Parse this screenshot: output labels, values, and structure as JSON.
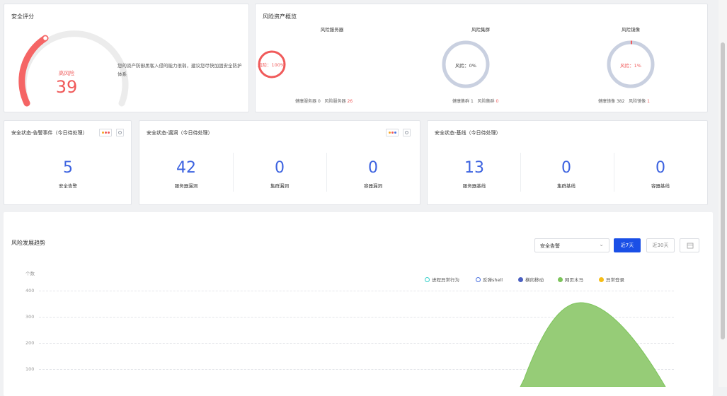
{
  "score_card": {
    "title": "安全评分",
    "level": "高风险",
    "score": "39",
    "description": "您的资产防御黑客入侵的能力很弱，建议您尽快加固安全防护体系",
    "colors": {
      "gauge": "#f56565",
      "track": "#ececec"
    }
  },
  "risk_overview": {
    "title": "风险资产概览",
    "items": [
      {
        "name": "风险服务器",
        "ring_text": "风险：100%",
        "ratio": 1.0,
        "color": "#f05a5a",
        "stat1_label": "健康服务器",
        "stat1_value": "0",
        "stat2_label": "风险服务器",
        "stat2_value": "26"
      },
      {
        "name": "风险集群",
        "ring_text": "风险：0%",
        "ratio": 0.0,
        "color": "#c9d0e0",
        "stat1_label": "健康集群",
        "stat1_value": "1",
        "stat2_label": "风险集群",
        "stat2_value": "0"
      },
      {
        "name": "风险镜像",
        "ring_text": "风险：1%",
        "ratio": 0.01,
        "color": "#f05a5a",
        "stat1_label": "健康镜像",
        "stat1_value": "382",
        "stat2_label": "风险镜像",
        "stat2_value": "1"
      }
    ]
  },
  "status_alarm": {
    "title": "安全状态-告警事件（今日待处理）",
    "items": [
      {
        "value": "5",
        "label": "安全告警"
      }
    ]
  },
  "status_vuln": {
    "title": "安全状态-漏洞（今日待处理）",
    "items": [
      {
        "value": "42",
        "label": "服务器漏洞"
      },
      {
        "value": "0",
        "label": "集群漏洞"
      },
      {
        "value": "0",
        "label": "容器漏洞"
      }
    ]
  },
  "status_baseline": {
    "title": "安全状态-基线（今日待处理）",
    "items": [
      {
        "value": "13",
        "label": "服务器基线"
      },
      {
        "value": "0",
        "label": "集群基线"
      },
      {
        "value": "0",
        "label": "容器基线"
      }
    ]
  },
  "trend": {
    "title": "风险发展趋势",
    "select_value": "安全告警",
    "btn_7": "近7天",
    "btn_30": "近30天",
    "ylabel": "个数",
    "legend": [
      {
        "name": "进程异常行为",
        "color": "#36cfc9",
        "hollow": true
      },
      {
        "name": "反弹shell",
        "color": "#4b72e0",
        "hollow": true
      },
      {
        "name": "横向移动",
        "color": "#4a5fc1",
        "hollow": false
      },
      {
        "name": "网页木马",
        "color": "#7cc45a",
        "hollow": false
      },
      {
        "name": "异常登录",
        "color": "#f6bd16",
        "hollow": false
      }
    ],
    "yticks": [
      "400",
      "300",
      "200",
      "100"
    ]
  },
  "chart_data": {
    "type": "area",
    "ylabel": "个数",
    "ylim": [
      0,
      400
    ],
    "series": [
      {
        "name": "网页木马",
        "peak": 355
      }
    ],
    "legend": [
      "进程异常行为",
      "反弹shell",
      "横向移动",
      "网页木马",
      "异常登录"
    ]
  },
  "colors": {
    "accent": "#1a4fe6",
    "number": "#3d63e0",
    "danger": "#f05a5a"
  }
}
